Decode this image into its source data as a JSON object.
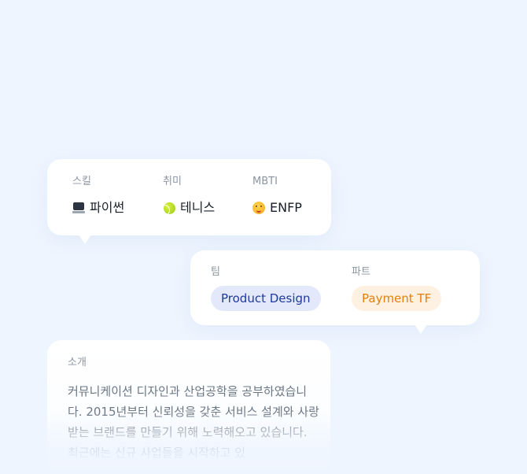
{
  "profile": {
    "skill": {
      "label": "스킬",
      "value": "파이썬",
      "icon": "laptop-icon"
    },
    "hobby": {
      "label": "취미",
      "value": "테니스",
      "icon": "tennis-ball-icon"
    },
    "mbti": {
      "label": "MBTI",
      "value": "ENFP",
      "icon": "smiling-face-icon"
    }
  },
  "org": {
    "team": {
      "label": "팀",
      "value": "Product Design",
      "color": "#1f3a9c",
      "background": "#e3e8fb"
    },
    "part": {
      "label": "파트",
      "value": "Payment TF",
      "color": "#e67e08",
      "background": "#fff1e1"
    }
  },
  "intro": {
    "label": "소개",
    "text": "커뮤니케이션 디자인과 산업공학을 공부하였습니다. 2015년부터 신뢰성을 갖춘 서비스 설계와 사랑받는 브랜드를 만들기 위해 노력해오고 있습니다. 최근에는 신규 사업들을 시작하고 있"
  },
  "colors": {
    "background": "#eef5ff",
    "card": "#ffffff",
    "label": "#8b95a1",
    "value": "#191f28"
  }
}
